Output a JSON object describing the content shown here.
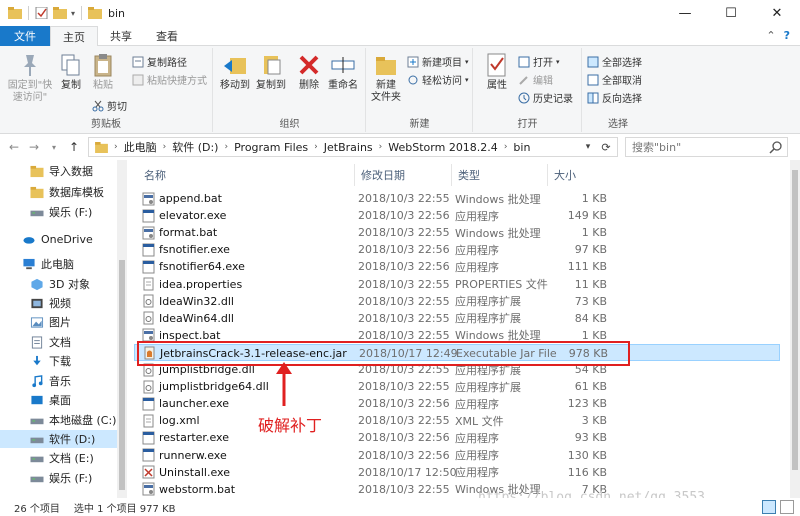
{
  "window": {
    "title": "bin",
    "controls": {
      "minimize": "—",
      "maximize": "☐",
      "close": "✕"
    }
  },
  "ribbon_tabs": [
    "文件",
    "主页",
    "共享",
    "查看"
  ],
  "ribbon": {
    "clipboard": {
      "label": "剪贴板",
      "pin": "固定到\"快\n速访问\"",
      "copy": "复制",
      "paste": "粘贴",
      "copy_path": "复制路径",
      "paste_shortcut": "粘贴快捷方式",
      "cut": "剪切"
    },
    "organize": {
      "label": "组织",
      "move_to": "移动到",
      "copy_to": "复制到",
      "delete": "删除",
      "rename": "重命名"
    },
    "new": {
      "label": "新建",
      "new_folder": "新建\n文件夹",
      "new_item": "新建项目",
      "easy_access": "轻松访问"
    },
    "open": {
      "label": "打开",
      "properties": "属性",
      "open": "打开",
      "edit": "编辑",
      "history": "历史记录"
    },
    "select": {
      "label": "选择",
      "select_all": "全部选择",
      "select_none": "全部取消",
      "invert": "反向选择"
    }
  },
  "address": {
    "crumbs": [
      "此电脑",
      "软件 (D:)",
      "Program Files",
      "JetBrains",
      "WebStorm 2018.2.4",
      "bin"
    ],
    "search_placeholder": "搜索\"bin\""
  },
  "nav_items": [
    {
      "label": "导入数据",
      "icon": "folder-icon"
    },
    {
      "label": "数据库模板",
      "icon": "folder-icon"
    },
    {
      "label": "娱乐 (F:)",
      "icon": "drive-icon"
    },
    {
      "label": "OneDrive",
      "icon": "cloud-icon"
    },
    {
      "label": "此电脑",
      "icon": "computer-icon"
    },
    {
      "label": "3D 对象",
      "icon": "cube-icon"
    },
    {
      "label": "视频",
      "icon": "video-icon"
    },
    {
      "label": "图片",
      "icon": "picture-icon"
    },
    {
      "label": "文档",
      "icon": "document-icon"
    },
    {
      "label": "下载",
      "icon": "download-icon"
    },
    {
      "label": "音乐",
      "icon": "music-icon"
    },
    {
      "label": "桌面",
      "icon": "desktop-icon"
    },
    {
      "label": "本地磁盘 (C:)",
      "icon": "drive-icon"
    },
    {
      "label": "软件 (D:)",
      "icon": "drive-icon"
    },
    {
      "label": "文档 (E:)",
      "icon": "drive-icon"
    },
    {
      "label": "娱乐 (F:)",
      "icon": "drive-icon"
    }
  ],
  "columns": [
    "名称",
    "修改日期",
    "类型",
    "大小"
  ],
  "files": [
    {
      "name": "append.bat",
      "date": "2018/10/3 22:55",
      "type": "Windows 批处理",
      "size": "1 KB",
      "icon": "batch-file-icon"
    },
    {
      "name": "elevator.exe",
      "date": "2018/10/3 22:56",
      "type": "应用程序",
      "size": "149 KB",
      "icon": "exe-file-icon"
    },
    {
      "name": "format.bat",
      "date": "2018/10/3 22:55",
      "type": "Windows 批处理",
      "size": "1 KB",
      "icon": "batch-file-icon"
    },
    {
      "name": "fsnotifier.exe",
      "date": "2018/10/3 22:56",
      "type": "应用程序",
      "size": "97 KB",
      "icon": "exe-file-icon"
    },
    {
      "name": "fsnotifier64.exe",
      "date": "2018/10/3 22:56",
      "type": "应用程序",
      "size": "111 KB",
      "icon": "exe-file-icon"
    },
    {
      "name": "idea.properties",
      "date": "2018/10/3 22:55",
      "type": "PROPERTIES 文件",
      "size": "11 KB",
      "icon": "text-file-icon"
    },
    {
      "name": "IdeaWin32.dll",
      "date": "2018/10/3 22:55",
      "type": "应用程序扩展",
      "size": "73 KB",
      "icon": "dll-file-icon"
    },
    {
      "name": "IdeaWin64.dll",
      "date": "2018/10/3 22:55",
      "type": "应用程序扩展",
      "size": "84 KB",
      "icon": "dll-file-icon"
    },
    {
      "name": "inspect.bat",
      "date": "2018/10/3 22:55",
      "type": "Windows 批处理",
      "size": "1 KB",
      "icon": "batch-file-icon"
    },
    {
      "name": "JetbrainsCrack-3.1-release-enc.jar",
      "date": "2018/10/17 12:49",
      "type": "Executable Jar File",
      "size": "978 KB",
      "icon": "jar-file-icon",
      "selected": true
    },
    {
      "name": "jumplistbridge.dll",
      "date": "2018/10/3 22:55",
      "type": "应用程序扩展",
      "size": "54 KB",
      "icon": "dll-file-icon"
    },
    {
      "name": "jumplistbridge64.dll",
      "date": "2018/10/3 22:55",
      "type": "应用程序扩展",
      "size": "61 KB",
      "icon": "dll-file-icon"
    },
    {
      "name": "launcher.exe",
      "date": "2018/10/3 22:56",
      "type": "应用程序",
      "size": "123 KB",
      "icon": "exe-file-icon"
    },
    {
      "name": "log.xml",
      "date": "2018/10/3 22:55",
      "type": "XML 文件",
      "size": "3 KB",
      "icon": "text-file-icon"
    },
    {
      "name": "restarter.exe",
      "date": "2018/10/3 22:56",
      "type": "应用程序",
      "size": "93 KB",
      "icon": "exe-file-icon"
    },
    {
      "name": "runnerw.exe",
      "date": "2018/10/3 22:56",
      "type": "应用程序",
      "size": "130 KB",
      "icon": "exe-file-icon"
    },
    {
      "name": "Uninstall.exe",
      "date": "2018/10/17 12:50",
      "type": "应用程序",
      "size": "116 KB",
      "icon": "uninstall-exe-icon"
    },
    {
      "name": "webstorm.bat",
      "date": "2018/10/3 22:55",
      "type": "Windows 批处理",
      "size": "7 KB",
      "icon": "batch-file-icon"
    }
  ],
  "annotation": "破解补丁",
  "watermark": "https://blog.csdn.net/qq_3553",
  "status": {
    "count": "26 个项目",
    "selected": "选中 1 个项目  977 KB"
  },
  "colors": {
    "file_tab": "#1979ca",
    "selection": "#cce8ff",
    "annotation": "#e02020"
  }
}
